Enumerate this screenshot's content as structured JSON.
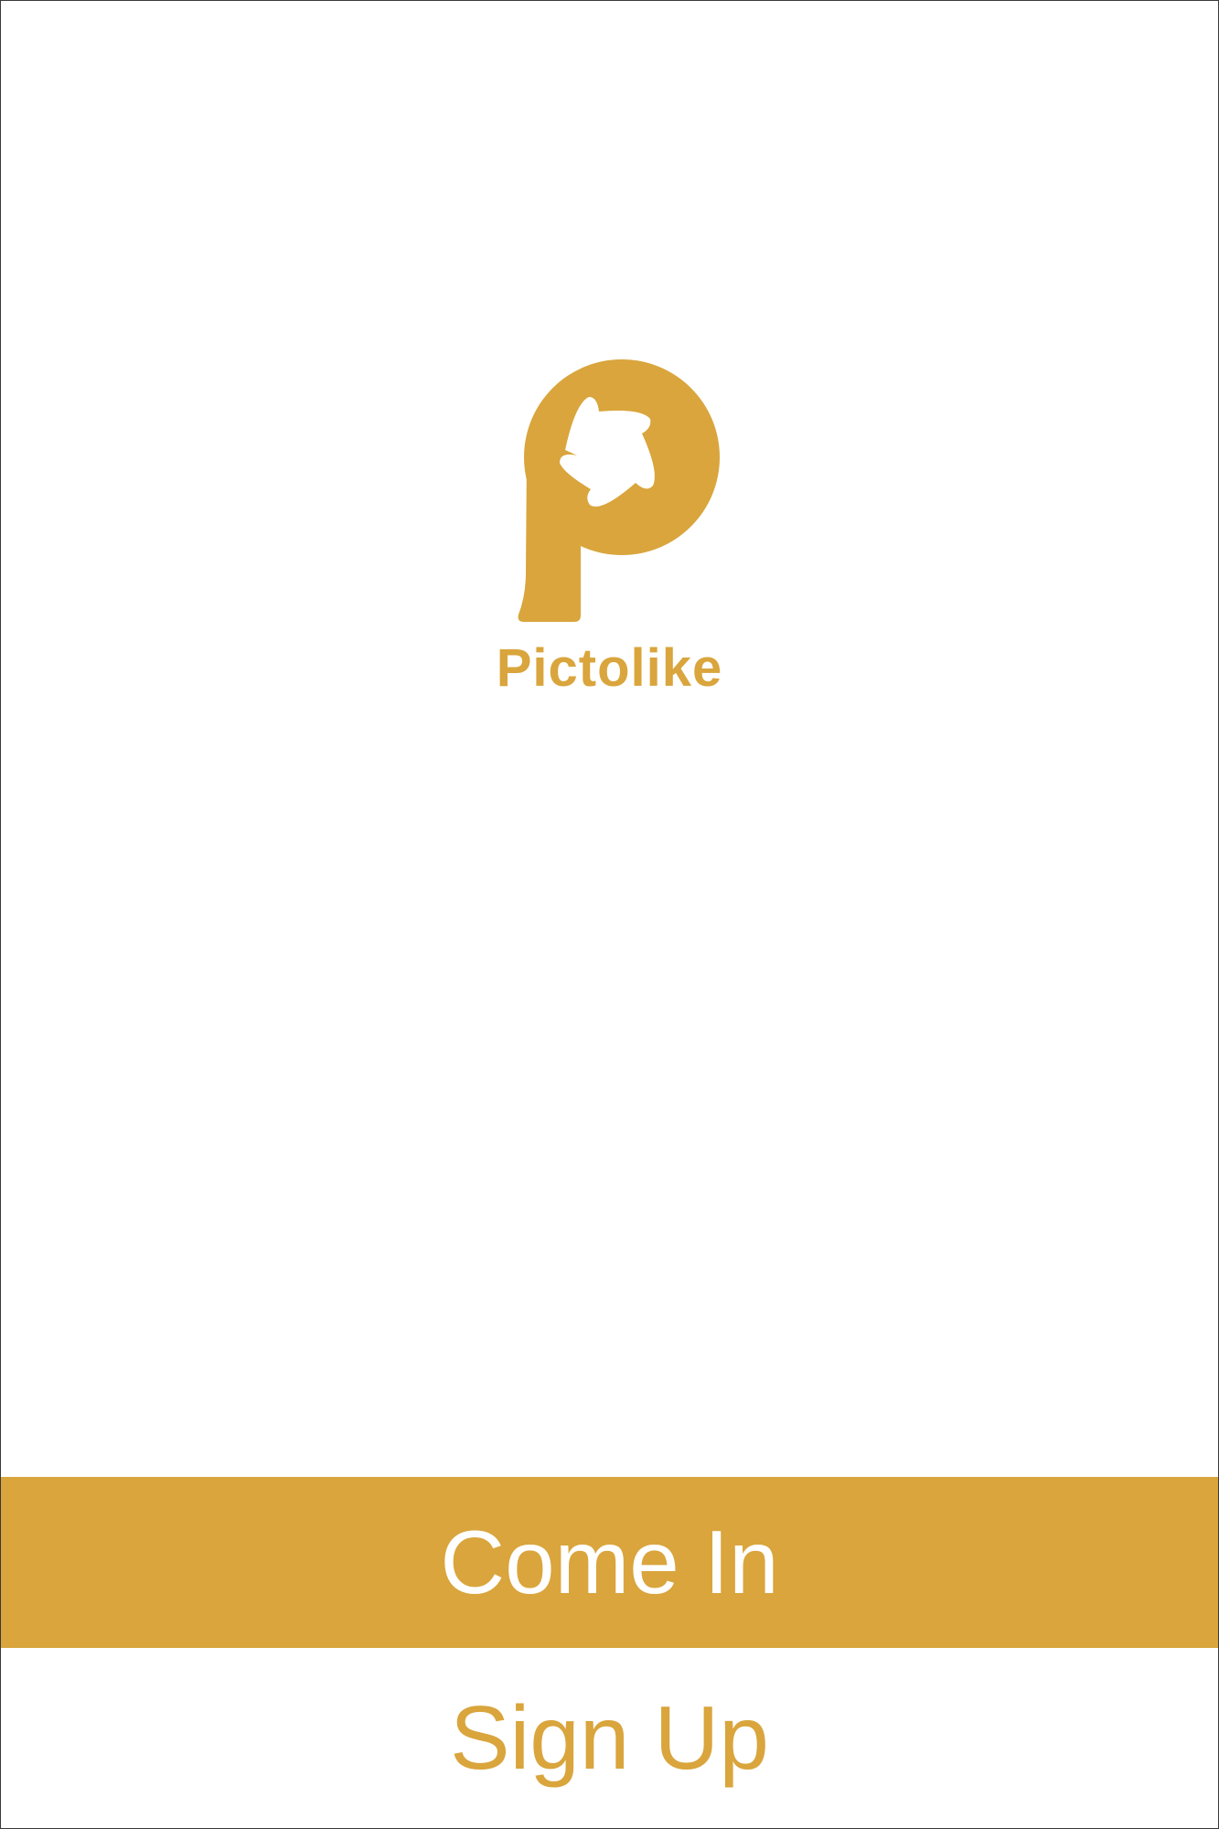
{
  "app": {
    "brand_name": "Pictolike",
    "logo_icon": "pictolike-p-logo-icon"
  },
  "actions": {
    "come_in_label": "Come In",
    "sign_up_label": "Sign Up"
  },
  "colors": {
    "brand": "#D9A53C",
    "background": "#FFFFFF",
    "button_text_primary": "#FFFFFF"
  }
}
